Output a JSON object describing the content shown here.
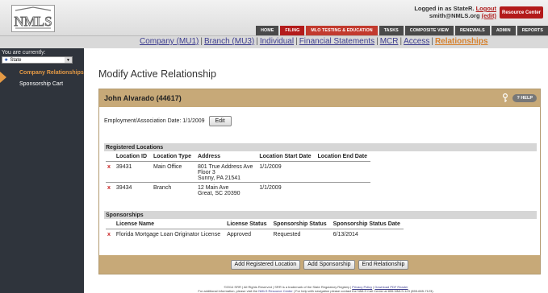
{
  "header": {
    "logo_text": "NMLS",
    "logged_in_prefix": "Logged in as StateR.",
    "logout_label": "Logout",
    "email": "smith@NMLS.org",
    "edit_label": "(edit)",
    "resource_center": "Resource Center",
    "nav": [
      "HOME",
      "FILING",
      "MLO TESTING & EDUCATION",
      "TASKS",
      "COMPOSITE VIEW",
      "RENEWALS",
      "ADMIN",
      "REPORTS"
    ]
  },
  "subnav": {
    "items": [
      "Company (MU1)",
      "Branch (MU3)",
      "Individual",
      "Financial Statements",
      "MCR",
      "Access",
      "Relationships"
    ]
  },
  "sidebar": {
    "you_are_currently": "You are currently:",
    "state_value": "State",
    "items": [
      "Company Relationships",
      "Sponsorship Cart"
    ]
  },
  "page": {
    "title": "Modify Active Relationship",
    "panel_title": "John Alvarado (44617)",
    "help_label": "HELP",
    "employment_label": "Employment/Association Date: 1/1/2009",
    "edit_button": "Edit",
    "registered_locations": {
      "heading": "Registered Locations",
      "columns": [
        "Location ID",
        "Location Type",
        "Address",
        "Location Start Date",
        "Location End Date"
      ],
      "rows": [
        {
          "id": "39431",
          "type": "Main Office",
          "addr1": "801 True Address Ave",
          "addr2": "Floor 3",
          "addr3": "Sunny, PA 21541",
          "start": "1/1/2009",
          "end": ""
        },
        {
          "id": "39434",
          "type": "Branch",
          "addr1": "12 Main Ave",
          "addr2": "Great, SC 20390",
          "addr3": "",
          "start": "1/1/2009",
          "end": ""
        }
      ]
    },
    "sponsorships": {
      "heading": "Sponsorships",
      "columns": [
        "License Name",
        "License Status",
        "Sponsorship Status",
        "Sponsorship Status Date"
      ],
      "rows": [
        {
          "name": "Florida Mortgage Loan Originator License",
          "license_status": "Approved",
          "sponsorship_status": "Requested",
          "date": "6/13/2014"
        }
      ]
    },
    "remove_glyph": "x",
    "buttons": [
      "Add Registered Location",
      "Add Sponsorship",
      "End Relationship"
    ]
  },
  "footer": {
    "line1": "©2014 SRR | All Rights Reserved | SRR is a trademark of the State Regulatory Registry |",
    "privacy": "Privacy Policy",
    "pdf": "Download PDF Reader",
    "line2_a": "For additional information, please visit the",
    "resource_link": "NMLS Resource Center",
    "line2_b": "| For help with navigation please contact the NMLS Call Center at 855-NMLS-123 (855-665-7123)."
  }
}
